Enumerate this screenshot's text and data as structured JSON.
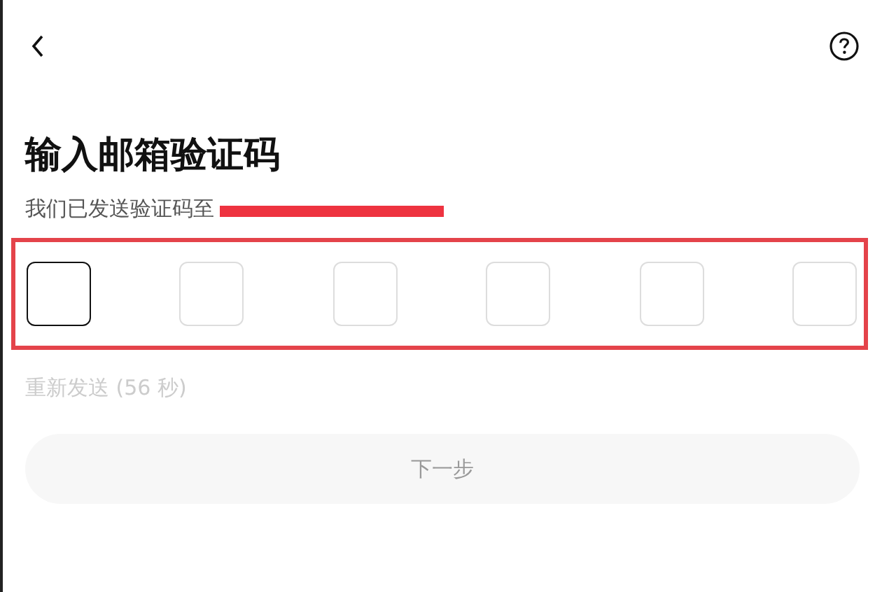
{
  "title": "输入邮箱验证码",
  "subtitle": "我们已发送验证码至",
  "code_boxes": [
    {
      "selected": true
    },
    {
      "selected": false
    },
    {
      "selected": false
    },
    {
      "selected": false
    },
    {
      "selected": false
    },
    {
      "selected": false
    }
  ],
  "resend": {
    "label": "重新发送 (56 秒)",
    "disabled": true
  },
  "next_button": {
    "label": "下一步",
    "disabled": true
  }
}
